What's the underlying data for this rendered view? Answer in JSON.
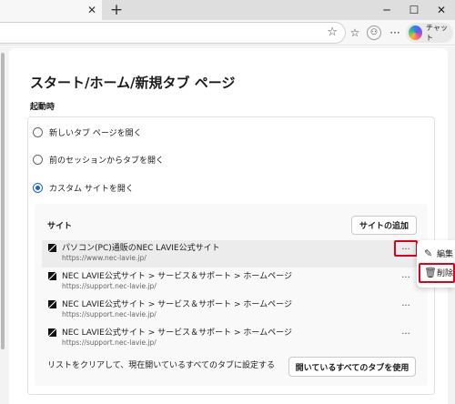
{
  "browser": {
    "tab_close_icon": "✕",
    "new_tab_icon": "+",
    "window_controls": {
      "minimize": "─",
      "maximize": "☐",
      "close": "✕"
    },
    "toolbar": {
      "favorite_icon": "☆",
      "favorites_icon": "☆",
      "profile_icon": "⚇",
      "menu_icon": "···",
      "chat_label": "チャット"
    }
  },
  "page": {
    "title": "スタート/ホーム/新規タブ ページ",
    "section_label": "起動時",
    "options": [
      {
        "label": "新しいタブ ページを開く",
        "checked": false
      },
      {
        "label": "前のセッションからタブを開く",
        "checked": false
      },
      {
        "label": "カスタム サイトを開く",
        "checked": true
      }
    ],
    "sites_heading": "サイト",
    "add_site_button": "サイトの追加",
    "more_icon": "···",
    "sites": [
      {
        "name": "パソコン(PC)通販のNEC LAVIE公式サイト",
        "url": "https://www.nec-lavie.jp/"
      },
      {
        "name": "NEC LAVIE公式サイト > サービス＆サポート > ホームページ",
        "url": "https://support.nec-lavie.jp/"
      },
      {
        "name": "NEC LAVIE公式サイト > サービス＆サポート > ホームページ",
        "url": "https://support.nec-lavie.jp/"
      },
      {
        "name": "NEC LAVIE公式サイト > サービス＆サポート > ホームページ",
        "url": "https://support.nec-lavie.jp/"
      }
    ],
    "context_menu": {
      "edit_icon": "✎",
      "edit_label": "編集",
      "delete_icon": "🗑",
      "delete_label": "削除"
    },
    "clear_text": "リストをクリアして、現在開いているすべてのタブに設定する",
    "use_open_tabs_button": "開いているすべてのタブを使用"
  },
  "colors": {
    "accent": "#1a65c9",
    "highlight": "#e0001b"
  }
}
